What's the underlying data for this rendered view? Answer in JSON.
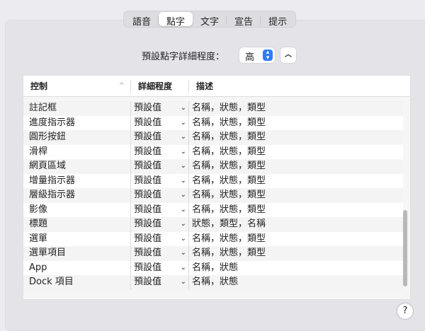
{
  "tabs": [
    {
      "label": "語音"
    },
    {
      "label": "點字",
      "active": true
    },
    {
      "label": "文字"
    },
    {
      "label": "宣告"
    },
    {
      "label": "提示"
    }
  ],
  "verbosity": {
    "label": "預設點字詳細程度：",
    "value": "高"
  },
  "table": {
    "headers": [
      "控制",
      "詳細程度",
      "描述"
    ],
    "rows": [
      [
        "註記框",
        "預設值",
        "名稱，狀態，類型"
      ],
      [
        "進度指示器",
        "預設值",
        "名稱，狀態，類型"
      ],
      [
        "圓形按鈕",
        "預設值",
        "名稱，狀態，類型"
      ],
      [
        "滑桿",
        "預設值",
        "名稱，狀態，類型"
      ],
      [
        "網頁區域",
        "預設值",
        "名稱，狀態，類型"
      ],
      [
        "增量指示器",
        "預設值",
        "名稱，狀態，類型"
      ],
      [
        "層級指示器",
        "預設值",
        "名稱，狀態，類型"
      ],
      [
        "影像",
        "預設值",
        "名稱，狀態，類型"
      ],
      [
        "標題",
        "預設值",
        "狀態，類型，名稱"
      ],
      [
        "選單",
        "預設值",
        "名稱，狀態，類型"
      ],
      [
        "選單項目",
        "預設值",
        "名稱，狀態，類型"
      ],
      [
        "App",
        "預設值",
        "名稱，狀態"
      ],
      [
        "Dock 項目",
        "預設值",
        "名稱，狀態"
      ]
    ]
  },
  "help_label": "?",
  "accent": "#2f7cf6"
}
